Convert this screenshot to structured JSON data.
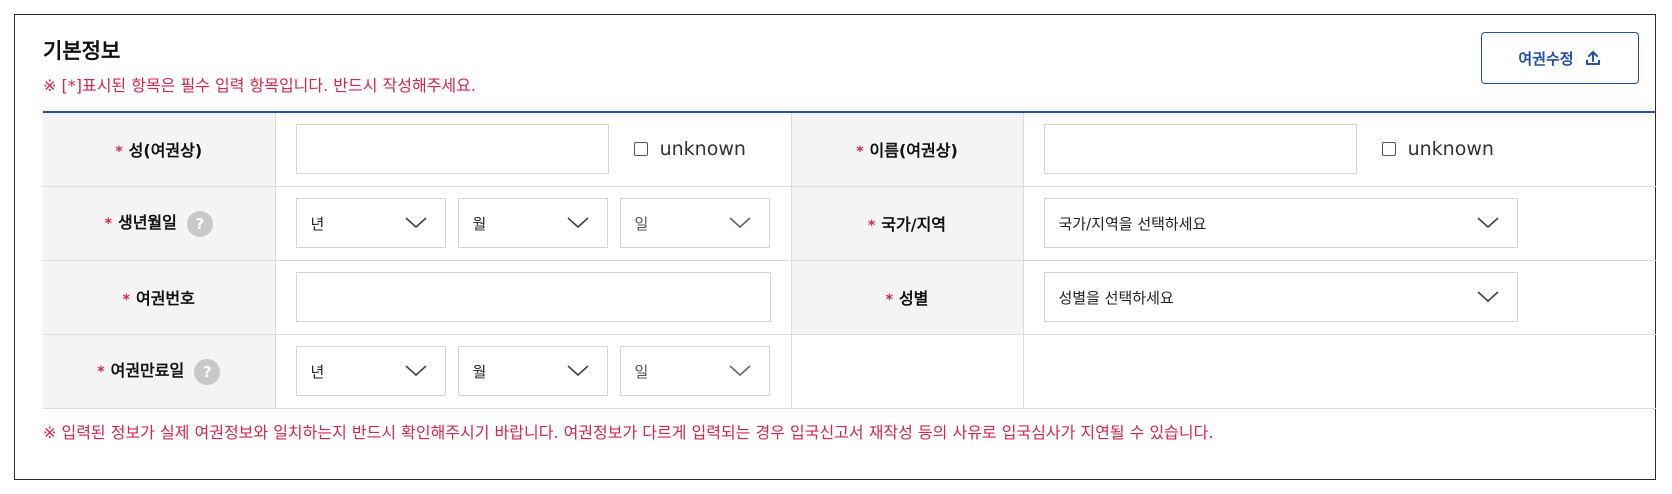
{
  "section": {
    "title": "기본정보",
    "notice": "※ [*]표시된 항목은 필수 입력 항목입니다. 반드시 작성해주세요.",
    "edit_button_label": "여권수정",
    "bottom_notice": "※ 입력된 정보가 실제 여권정보와 일치하는지 반드시 확인해주시기 바랍니다. 여권정보가 다르게 입력되는 경우 입국신고서 재작성 등의 사유로 입국심사가 지연될 수 있습니다."
  },
  "required_mark": "*",
  "help_mark": "?",
  "fields": {
    "surname": {
      "label": "성(여권상)",
      "value": "",
      "unknown_label": "unknown"
    },
    "given_name": {
      "label": "이름(여권상)",
      "value": "",
      "unknown_label": "unknown"
    },
    "birth_date": {
      "label": "생년월일",
      "year": "년",
      "month": "월",
      "day": "일"
    },
    "country": {
      "label": "국가/지역",
      "selected": "국가/지역을 선택하세요"
    },
    "passport_number": {
      "label": "여권번호",
      "value": ""
    },
    "gender": {
      "label": "성별",
      "selected": "성별을 선택하세요"
    },
    "expiry_date": {
      "label": "여권만료일",
      "year": "년",
      "month": "월",
      "day": "일"
    }
  },
  "colors": {
    "accent": "#1f4fa8",
    "required": "#d7264a",
    "label_bg": "#f4f4f4"
  }
}
